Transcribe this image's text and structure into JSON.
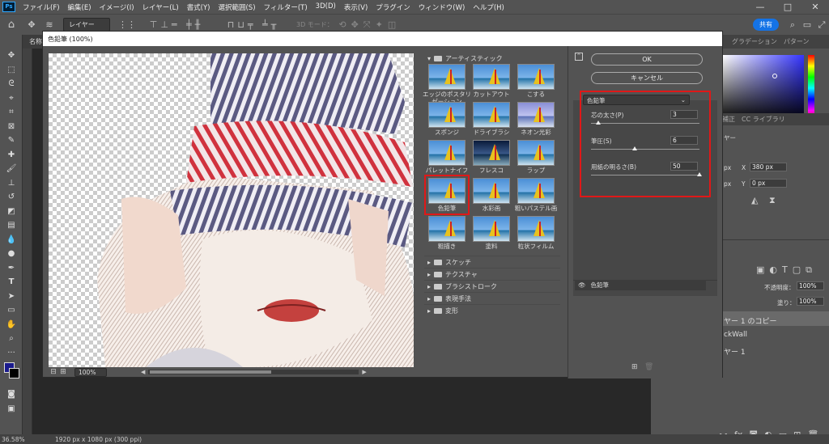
{
  "app": {
    "logo": "Ps",
    "menu": [
      "ファイル(F)",
      "編集(E)",
      "イメージ(I)",
      "レイヤー(L)",
      "書式(Y)",
      "選択範囲(S)",
      "フィルター(T)",
      "3D(D)",
      "表示(V)",
      "プラグイン",
      "ウィンドウ(W)",
      "ヘルプ(H)"
    ],
    "window_controls": [
      "—",
      "□",
      "✕"
    ]
  },
  "options_bar": {
    "layer_select": "レイヤー",
    "mode_3d": "3D モード：",
    "share_button": "共有"
  },
  "document_tab": "名称",
  "status_bar": {
    "zoom": "36.58%",
    "doc_info": "1920 px x 1080 px (300 ppi)"
  },
  "right_panel": {
    "tabs_top": [
      "グラデーション",
      "パターン"
    ],
    "tabs_mid": [
      "補正",
      "CC ライブラリ"
    ],
    "prop_label": "ヤー",
    "x_label": "X",
    "x_value": "380 px",
    "y_label": "Y",
    "y_value": "0 px",
    "w_value": "px",
    "h_value": "px",
    "opacity_label": "不透明度：",
    "opacity_value": "100%",
    "fill_label": "塗り：",
    "fill_value": "100%",
    "layers": [
      "ヤー 1 のコピー",
      "ckWall",
      "ヤー 1"
    ]
  },
  "dialog": {
    "title": "色鉛筆 (100%)",
    "zoom": "100%",
    "ok": "OK",
    "cancel": "キャンセル",
    "filter_select": "色鉛筆",
    "gallery_header": "アーティスティック",
    "thumbnails": [
      "エッジのポスタリゼーション",
      "カットアウト",
      "こする",
      "スポンジ",
      "ドライブラシ",
      "ネオン光彩",
      "パレットナイフ",
      "フレスコ",
      "ラップ",
      "色鉛筆",
      "水彩画",
      "粗いパステル画",
      "粗描き",
      "塗料",
      "粒状フィルム"
    ],
    "categories": [
      "スケッチ",
      "テクスチャ",
      "ブラシストローク",
      "表現手法",
      "変形"
    ],
    "params": [
      {
        "label": "芯の太さ(P)",
        "value": "3",
        "fraction": 0.07
      },
      {
        "label": "筆圧(S)",
        "value": "6",
        "fraction": 0.4
      },
      {
        "label": "用紙の明るさ(B)",
        "value": "50",
        "fraction": 1.0
      }
    ],
    "effect_layer": "色鉛筆"
  }
}
